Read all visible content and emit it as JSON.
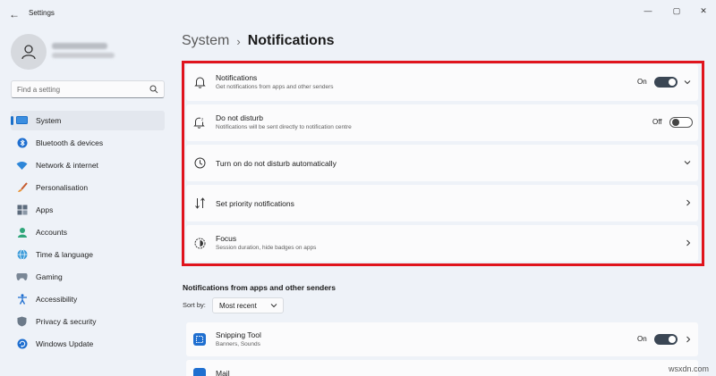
{
  "window": {
    "title": "Settings",
    "back_glyph": "←",
    "minimize_glyph": "—",
    "maximize_glyph": "▢",
    "close_glyph": "✕"
  },
  "search": {
    "placeholder": "Find a setting"
  },
  "sidebar": {
    "items": [
      {
        "label": "System",
        "icon": "system-icon",
        "active": true
      },
      {
        "label": "Bluetooth & devices",
        "icon": "bluetooth-icon"
      },
      {
        "label": "Network & internet",
        "icon": "network-icon"
      },
      {
        "label": "Personalisation",
        "icon": "brush-icon"
      },
      {
        "label": "Apps",
        "icon": "apps-icon"
      },
      {
        "label": "Accounts",
        "icon": "accounts-icon"
      },
      {
        "label": "Time & language",
        "icon": "globe-icon"
      },
      {
        "label": "Gaming",
        "icon": "gaming-icon"
      },
      {
        "label": "Accessibility",
        "icon": "accessibility-icon"
      },
      {
        "label": "Privacy & security",
        "icon": "shield-icon"
      },
      {
        "label": "Windows Update",
        "icon": "update-icon"
      }
    ]
  },
  "breadcrumb": {
    "parent": "System",
    "separator": "›",
    "current": "Notifications"
  },
  "cards": {
    "notifications": {
      "title": "Notifications",
      "subtitle": "Get notifications from apps and other senders",
      "toggle_label": "On",
      "toggle_on": true
    },
    "dnd": {
      "title": "Do not disturb",
      "subtitle": "Notifications will be sent directly to notification centre",
      "toggle_label": "Off",
      "toggle_on": false
    },
    "dnd_auto": {
      "title": "Turn on do not disturb automatically"
    },
    "priority": {
      "title": "Set priority notifications"
    },
    "focus": {
      "title": "Focus",
      "subtitle": "Session duration, hide badges on apps"
    }
  },
  "senders": {
    "section_title": "Notifications from apps and other senders",
    "sort_label": "Sort by:",
    "sort_value": "Most recent",
    "apps": [
      {
        "name": "Snipping Tool",
        "subtitle": "Banners, Sounds",
        "toggle_label": "On",
        "toggle_on": true
      },
      {
        "name": "Mail"
      }
    ]
  },
  "watermark": "wsxdn.com",
  "colors": {
    "accent": "#1a6fc9",
    "highlight": "#e0141d",
    "toggle_on": "#3a4654"
  }
}
